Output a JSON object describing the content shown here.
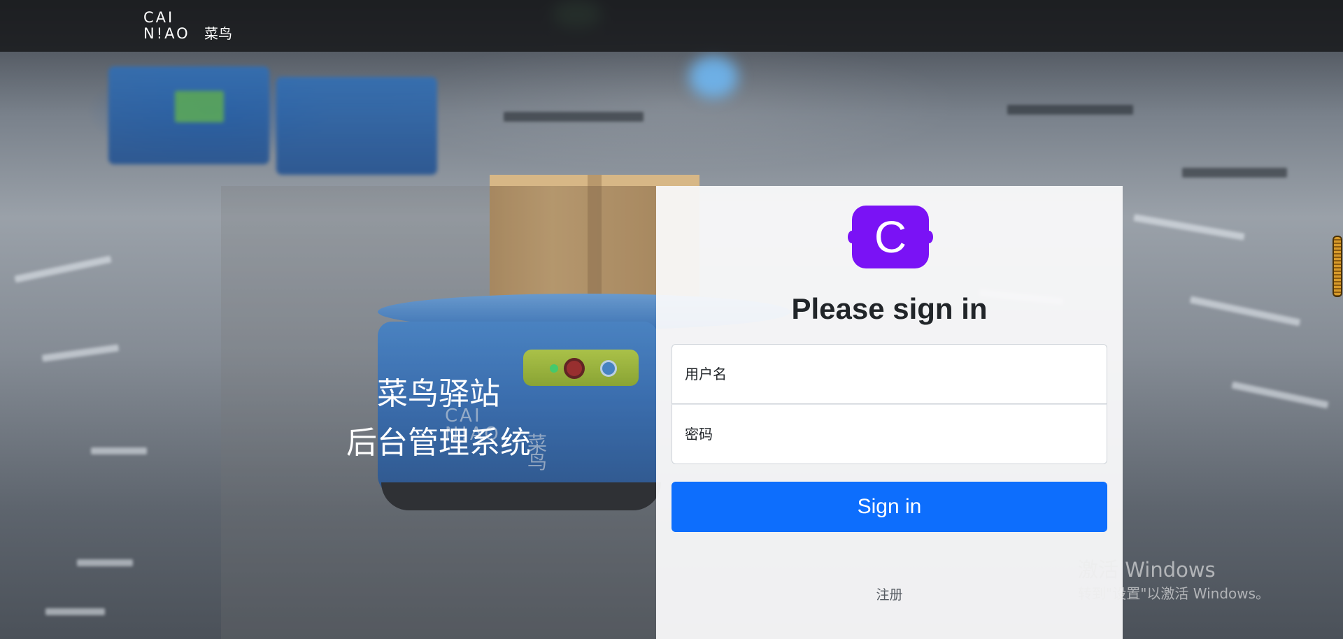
{
  "header": {
    "brand_line1": "CAI",
    "brand_line2": "N!AO",
    "brand_cn": "菜鸟"
  },
  "hero": {
    "line1": "菜鸟驿站",
    "line2": "后台管理系统",
    "robot_logo_line1": "CAI",
    "robot_logo_line2": "N!AO",
    "robot_logo_cn": "菜鸟"
  },
  "login": {
    "logo_letter": "C",
    "title": "Please sign in",
    "username_placeholder": "用户名",
    "password_placeholder": "密码",
    "submit_label": "Sign in",
    "register_link": "注册"
  },
  "watermark": {
    "line1": "激活 Windows",
    "line2": "转到\"设置\"以激活 Windows。"
  },
  "colors": {
    "primary_button": "#0d6efd",
    "logo_badge": "#7a12f5",
    "header_bg": "#1a1a1c"
  },
  "icons": {
    "brand_logo": "cainiao-logo",
    "login_logo": "bootstrap-style-c-logo"
  }
}
